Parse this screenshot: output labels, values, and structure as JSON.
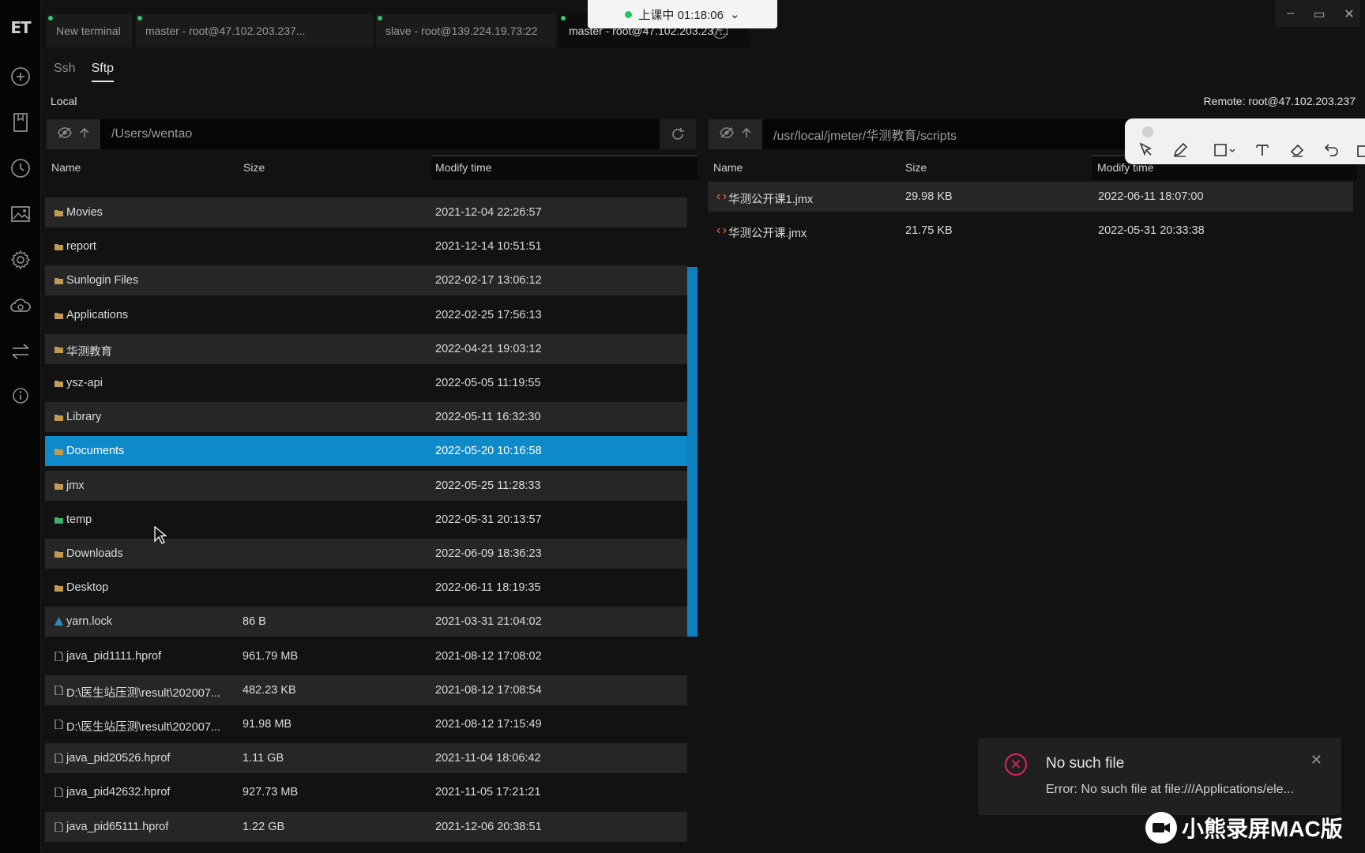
{
  "app": {
    "logo_text": "ET",
    "rail_icons": [
      "plus-circle-icon",
      "bookmark-icon",
      "history-icon",
      "image-icon",
      "gear-icon",
      "cloud-sync-icon",
      "transfer-icon",
      "info-icon"
    ]
  },
  "tabs": [
    {
      "label": "New terminal"
    },
    {
      "label": "master - root@47.102.203.237..."
    },
    {
      "label": "slave - root@139.224.19.73:22"
    },
    {
      "label": "master - root@47.102.203.237..."
    }
  ],
  "recording": {
    "label": "上课中 01:18:06",
    "dropdown": "⌄"
  },
  "window_controls": {
    "minimize": "–",
    "restore": "▭",
    "close": "✕"
  },
  "subtabs": [
    {
      "label": "Ssh"
    },
    {
      "label": "Sftp"
    }
  ],
  "local": {
    "label": "Local",
    "path": "/Users/wentao",
    "columns": {
      "name": "Name",
      "size": "Size",
      "modified": "Modify time"
    },
    "files": [
      {
        "name": "Movies",
        "size": "",
        "modified": "2021-12-04 22:26:57",
        "type": "folder"
      },
      {
        "name": "report",
        "size": "",
        "modified": "2021-12-14 10:51:51",
        "type": "folder"
      },
      {
        "name": "Sunlogin Files",
        "size": "",
        "modified": "2022-02-17 13:06:12",
        "type": "folder"
      },
      {
        "name": "Applications",
        "size": "",
        "modified": "2022-02-25 17:56:13",
        "type": "folder"
      },
      {
        "name": "华测教育",
        "size": "",
        "modified": "2022-04-21 19:03:12",
        "type": "folder"
      },
      {
        "name": "ysz-api",
        "size": "",
        "modified": "2022-05-05 11:19:55",
        "type": "folder"
      },
      {
        "name": "Library",
        "size": "",
        "modified": "2022-05-11 16:32:30",
        "type": "folder"
      },
      {
        "name": "Documents",
        "size": "",
        "modified": "2022-05-20 10:16:58",
        "type": "folder"
      },
      {
        "name": "jmx",
        "size": "",
        "modified": "2022-05-25 11:28:33",
        "type": "folder"
      },
      {
        "name": "temp",
        "size": "",
        "modified": "2022-05-31 20:13:57",
        "type": "folder-green"
      },
      {
        "name": "Downloads",
        "size": "",
        "modified": "2022-06-09 18:36:23",
        "type": "folder"
      },
      {
        "name": "Desktop",
        "size": "",
        "modified": "2022-06-11 18:19:35",
        "type": "folder"
      },
      {
        "name": "yarn.lock",
        "size": "86 B",
        "modified": "2021-03-31 21:04:02",
        "type": "yarn"
      },
      {
        "name": "java_pid1111.hprof",
        "size": "961.79 MB",
        "modified": "2021-08-12 17:08:02",
        "type": "file"
      },
      {
        "name": "D:\\医生站压测\\result\\202007...",
        "size": "482.23 KB",
        "modified": "2021-08-12 17:08:54",
        "type": "file"
      },
      {
        "name": "D:\\医生站压测\\result\\202007...",
        "size": "91.98 MB",
        "modified": "2021-08-12 17:15:49",
        "type": "file"
      },
      {
        "name": "java_pid20526.hprof",
        "size": "1.11 GB",
        "modified": "2021-11-04 18:06:42",
        "type": "file"
      },
      {
        "name": "java_pid42632.hprof",
        "size": "927.73 MB",
        "modified": "2021-11-05 17:21:21",
        "type": "file"
      },
      {
        "name": "java_pid65111.hprof",
        "size": "1.22 GB",
        "modified": "2021-12-06 20:38:51",
        "type": "file"
      }
    ],
    "selected": "Documents"
  },
  "remote": {
    "label": "Remote: root@47.102.203.237",
    "path": "/usr/local/jmeter/华测教育/scripts",
    "columns": {
      "name": "Name",
      "size": "Size",
      "modified": "Modify time"
    },
    "files": [
      {
        "name": "华测公开课1.jmx",
        "size": "29.98 KB",
        "modified": "2022-06-11 18:07:00",
        "type": "code"
      },
      {
        "name": "华测公开课.jmx",
        "size": "21.75 KB",
        "modified": "2022-05-31 20:33:38",
        "type": "code"
      }
    ]
  },
  "annotation_toolbar": {
    "tools": [
      "select-arrow-icon",
      "pen-icon",
      "rectangle-icon",
      "text-icon",
      "eraser-icon",
      "undo-icon",
      "trash-icon"
    ]
  },
  "toast": {
    "title": "No such file",
    "message": "Error: No such file at file:///Applications/ele...",
    "close": "✕"
  },
  "watermark": {
    "text": "小熊录屏MAC版"
  },
  "colors": {
    "selection": "#0e89c9",
    "error": "#e0245e",
    "active_dot": "#2ecc71"
  }
}
